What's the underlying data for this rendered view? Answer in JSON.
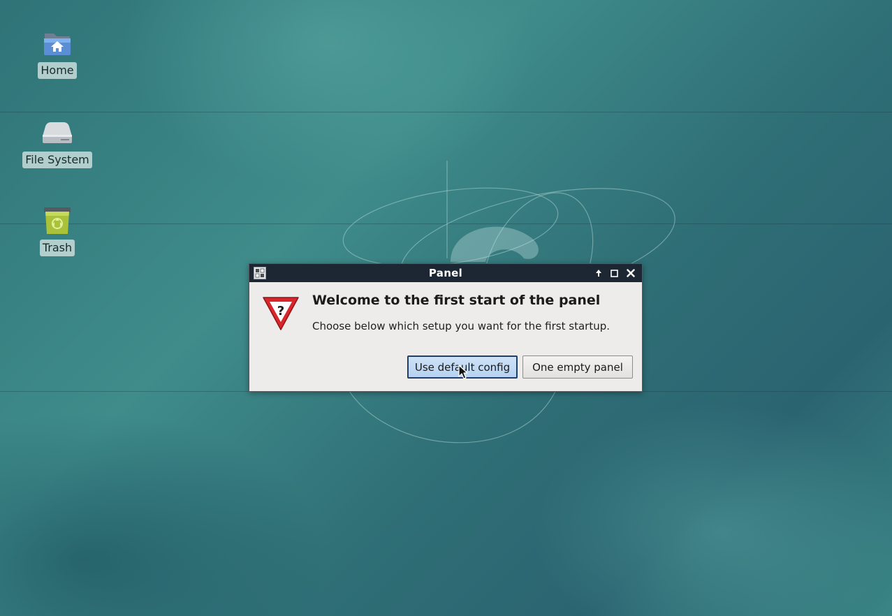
{
  "desktop": {
    "icons": [
      {
        "label": "Home",
        "icon": "home-folder-icon"
      },
      {
        "label": "File System",
        "icon": "drive-icon"
      },
      {
        "label": "Trash",
        "icon": "trash-icon"
      }
    ]
  },
  "dialog": {
    "title": "Panel",
    "heading": "Welcome to the first start of the panel",
    "message": "Choose below which setup you want for the first startup.",
    "icon": "warning-question-icon",
    "buttons": {
      "default": "Use default config",
      "empty": "One empty panel"
    },
    "controls": [
      "keep-above-icon",
      "maximize-icon",
      "close-icon"
    ]
  },
  "colors": {
    "titlebar": "#1d2733",
    "dialog_bg": "#edecea",
    "focused_button": "#b5d2f1",
    "warning_red": "#d9262b"
  }
}
